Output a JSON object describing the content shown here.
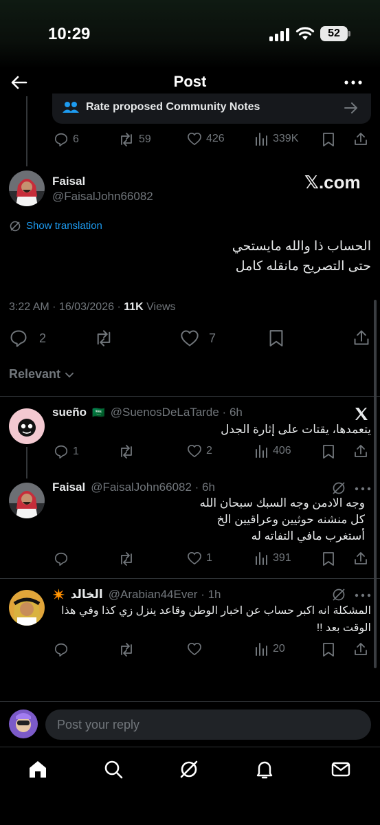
{
  "status_bar": {
    "time": "10:29",
    "battery": "52"
  },
  "header": {
    "title": "Post"
  },
  "community_notes": {
    "label": "Rate proposed Community Notes"
  },
  "prev_tweet_actions": {
    "replies": "6",
    "reposts": "59",
    "likes": "426",
    "views": "339K"
  },
  "main_tweet": {
    "name": "Faisal",
    "handle": "@FaisalJohn66082",
    "watermark": "𝕏.com",
    "show_translation": "Show translation",
    "line1": "الحساب ذا والله مايستحي",
    "line2": "حتى التصريح مانقله كامل",
    "time": "3:22 AM · 16/03/2026 · ",
    "views_count": "11K",
    "views_label": " Views",
    "replies": "2",
    "likes": "7"
  },
  "sort": {
    "label": "Relevant"
  },
  "replies": [
    {
      "name": "sueño",
      "flag": "🇸🇦",
      "handle": "@SuenosDeLaTarde · 6h",
      "text": "يتعمدها، يقتات على إثارة الجدل",
      "replies": "1",
      "likes": "2",
      "views": "406"
    },
    {
      "name": "Faisal",
      "handle": "@FaisalJohn66082 · 6h",
      "line1": "وجه الادمن وجه السبك سبحان الله",
      "line2": "كل منشنه حوثيين وعراقيين الخ",
      "line3": "أستغرب مافي التفاته له",
      "likes": "1",
      "views": "391"
    },
    {
      "name": "الخالد",
      "badge": "✴️",
      "handle": "@Arabian44Ever · 1h",
      "line1": "المشكلة انه اكبر حساب عن اخبار الوطن وقاعد ينزل زي كذا وفي هذا",
      "line2": "الوقت بعد !!",
      "views": "20"
    }
  ],
  "reply_box": {
    "placeholder": "Post your reply"
  },
  "colors": {
    "accent": "#1d9bf0",
    "muted": "#71767b",
    "background": "#000000"
  }
}
